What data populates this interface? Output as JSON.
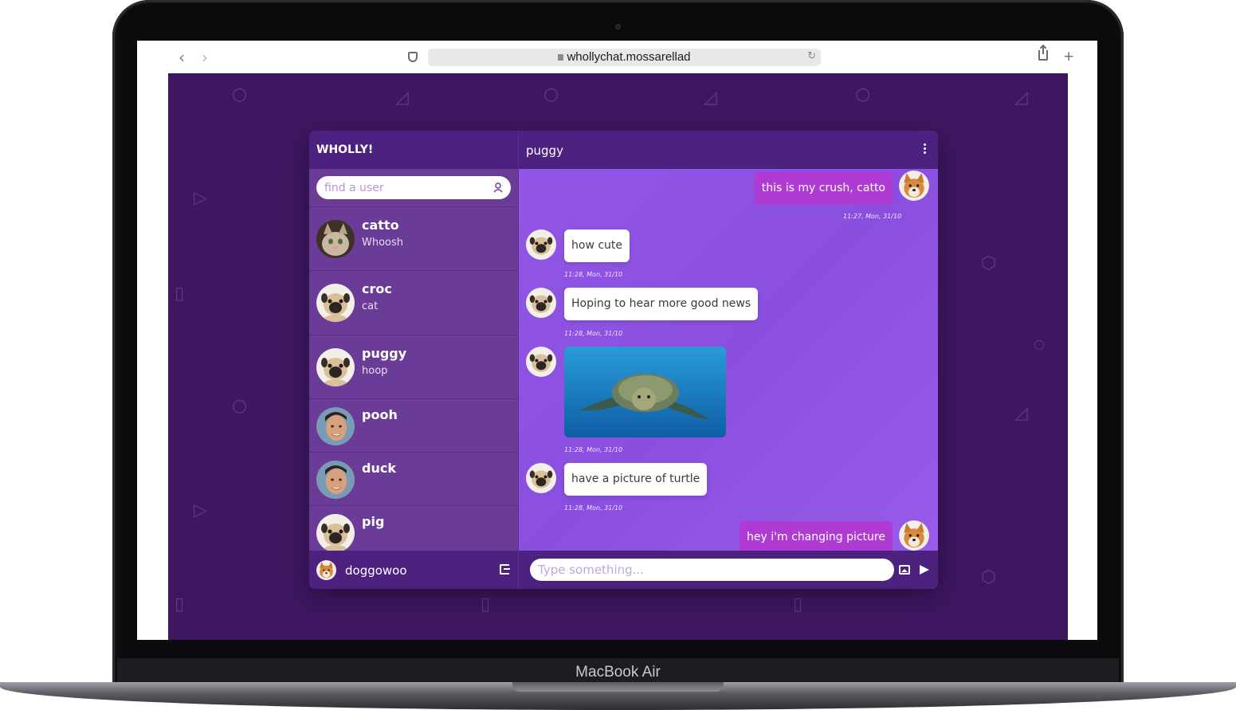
{
  "device": {
    "label": "MacBook Air"
  },
  "browser": {
    "url": "whollychat.mossarellad",
    "back": "‹",
    "forward": "›",
    "reload": "↻",
    "newtab": "+"
  },
  "app": {
    "brand": "WHOLLY!",
    "search": {
      "placeholder": "find a user"
    },
    "contacts": [
      {
        "name": "catto",
        "status": "Whoosh",
        "avatar": "cat"
      },
      {
        "name": "croc",
        "status": "cat",
        "avatar": "pug"
      },
      {
        "name": "puggy",
        "status": "hoop",
        "avatar": "pug"
      },
      {
        "name": "pooh",
        "status": "",
        "avatar": "man"
      },
      {
        "name": "duck",
        "status": "",
        "avatar": "man"
      },
      {
        "name": "pig",
        "status": "",
        "avatar": "pug"
      }
    ],
    "me": {
      "name": "doggowoo",
      "avatar": "shiba"
    },
    "chat": {
      "title": "puggy",
      "messages": [
        {
          "dir": "out",
          "text": "this is my crush, catto",
          "time": "11:27, Mon, 31/10"
        },
        {
          "dir": "in",
          "text": "how cute",
          "time": "11:28, Mon, 31/10"
        },
        {
          "dir": "in",
          "text": "Hoping to hear more good news",
          "time": "11:28, Mon, 31/10"
        },
        {
          "dir": "in",
          "image": "turtle",
          "time": "11:28, Mon, 31/10"
        },
        {
          "dir": "in",
          "text": "have a picture of turtle",
          "time": "11:28, Mon, 31/10"
        },
        {
          "dir": "out",
          "text": "hey i'm changing picture",
          "time": ""
        }
      ]
    },
    "composer": {
      "placeholder": "Type something..."
    },
    "colors": {
      "page_bg": "#3e1760",
      "header_bg": "#4d2180",
      "sidebar_bg": "#6a3c97",
      "chat_bg": "#9357e6",
      "outgoing_bubble": "#b03bd3"
    }
  }
}
